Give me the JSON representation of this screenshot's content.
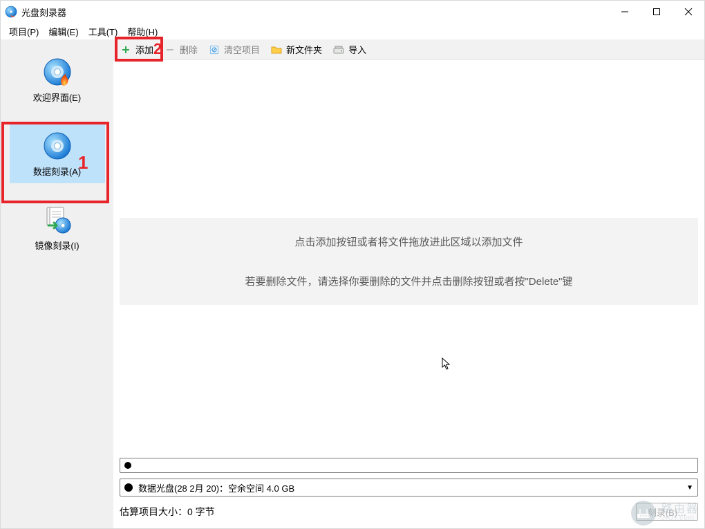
{
  "window": {
    "title": "光盘刻录器"
  },
  "menu": {
    "project": "项目(P)",
    "edit": "编辑(E)",
    "tools": "工具(T)",
    "help": "帮助(H)"
  },
  "sidebar": {
    "welcome": {
      "label": "欢迎界面(E)"
    },
    "data_burn": {
      "label": "数据刻录(A)",
      "callout": "1"
    },
    "image_burn": {
      "label": "镜像刻录(I)"
    }
  },
  "toolbar": {
    "add": "添加",
    "delete": "删除",
    "clear": "清空项目",
    "new_folder": "新文件夹",
    "import": "导入",
    "callout": "2"
  },
  "main": {
    "hint1": "点击添加按钮或者将文件拖放进此区域以添加文件",
    "hint2": "若要删除文件，请选择你要删除的文件并点击删除按钮或者按\"Delete\"键"
  },
  "bottom": {
    "disc_label": "数据光盘(28 2月 20)：空余空间 4.0 GB",
    "dropdown_arrow": "▼",
    "size_label": "估算项目大小：0 字节",
    "burn_label": "刻录(B)…"
  },
  "watermark": {
    "line1": "路由器",
    "line2": "JIQI.com"
  }
}
